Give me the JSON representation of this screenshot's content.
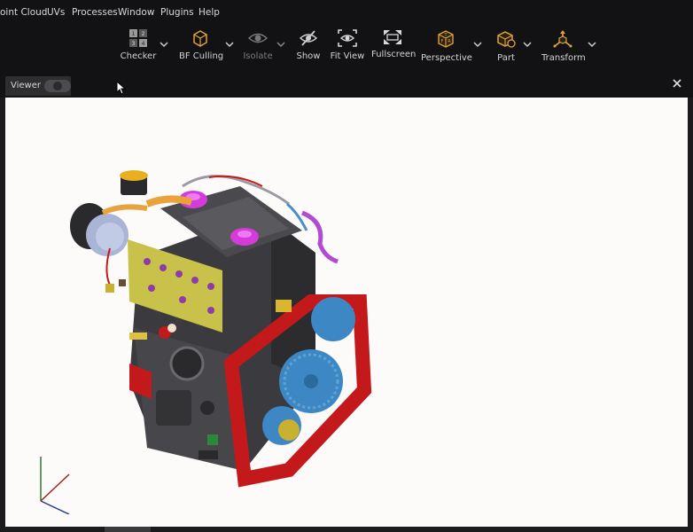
{
  "menu": {
    "items": [
      {
        "label": "oint Cloud"
      },
      {
        "label": "UVs"
      },
      {
        "label": "Processes"
      },
      {
        "label": "Window"
      },
      {
        "label": "Plugins"
      },
      {
        "label": "Help"
      }
    ]
  },
  "toolbar": {
    "buttons": [
      {
        "label": "Checker",
        "icon": "checker-icon",
        "dropdown": true,
        "enabled": true
      },
      {
        "label": "BF Culling",
        "icon": "cube-icon",
        "dropdown": true,
        "enabled": true
      },
      {
        "label": "Isolate",
        "icon": "eye-icon",
        "dropdown": true,
        "enabled": false
      },
      {
        "label": "Show",
        "icon": "eye-slash-icon",
        "dropdown": false,
        "enabled": true
      },
      {
        "label": "Fit View",
        "icon": "fit-view-icon",
        "dropdown": false,
        "enabled": true
      },
      {
        "label": "Fullscreen",
        "icon": "fullscreen-icon",
        "dropdown": false,
        "enabled": true
      },
      {
        "label": "Perspective",
        "icon": "perspective-cube-icon",
        "dropdown": true,
        "enabled": true
      },
      {
        "label": "Part",
        "icon": "part-icon",
        "dropdown": true,
        "enabled": true
      },
      {
        "label": "Transform",
        "icon": "transform-gizmo-icon",
        "dropdown": true,
        "enabled": true
      }
    ]
  },
  "viewer": {
    "tab_label": "Viewer",
    "close_label": "close-icon",
    "scene": "3D engine model",
    "colors": {
      "background": "#fdfafa",
      "accent": "#e8a33a",
      "block": "#3a3a3d",
      "head_yellow": "#c9c24a",
      "gear_blue": "#3d88c4",
      "frame_red": "#c4191b",
      "magenta": "#d43cd9"
    }
  }
}
